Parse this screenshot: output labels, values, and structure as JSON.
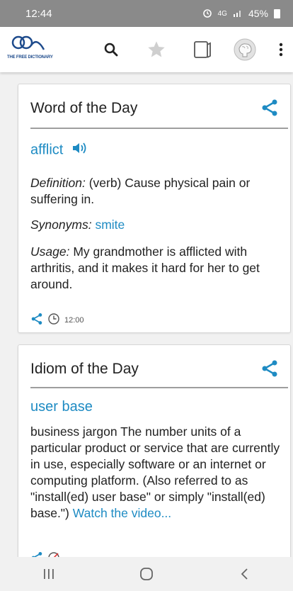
{
  "status_bar": {
    "time": "12:44",
    "signal": "4G",
    "battery": "45%"
  },
  "app_bar": {
    "logo_text": "THE FREE DICTIONARY",
    "icons": [
      "search-icon",
      "star-icon",
      "bookmark-icon",
      "brain-icon",
      "more-icon"
    ]
  },
  "word_card": {
    "title": "Word of the Day",
    "word": "afflict",
    "definition_label": "Definition:",
    "definition_text": " (verb) Cause physical pain or suffering in.",
    "synonyms_label": "Synonyms:",
    "synonym": "smite",
    "usage_label": "Usage:",
    "usage_text": " My grandmother is afflicted with arthritis, and it makes it hard for her to get around.",
    "time": "12:00"
  },
  "idiom_card": {
    "title": "Idiom of the Day",
    "idiom": "user base",
    "description": "business jargon The number units of a particular product or service that are currently in use, especially software or an internet or computing platform. (Also referred to as \"install(ed) user base\" or simply \"install(ed) base.\")",
    "link_text": "Watch the video..."
  },
  "colors": {
    "accent": "#1e8bc3",
    "status_bar": "#8a8a8a"
  }
}
